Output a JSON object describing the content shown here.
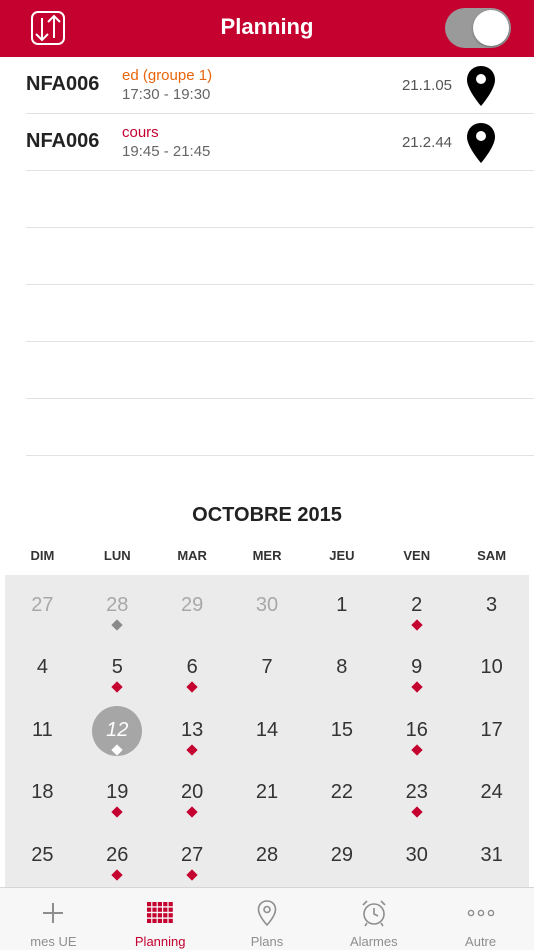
{
  "header": {
    "title": "Planning",
    "toggle_on": true
  },
  "colors": {
    "brand": "#c4012f",
    "ed_type": "#e8650a",
    "cours_type": "#c4012f"
  },
  "schedule": [
    {
      "code": "NFA006",
      "type": "ed (groupe 1)",
      "time": "17:30 - 19:30",
      "room": "21.1.05",
      "type_color": "#e8650a"
    },
    {
      "code": "NFA006",
      "type": "cours",
      "time": "19:45 - 21:45",
      "room": "21.2.44",
      "type_color": "#c4012f"
    }
  ],
  "calendar": {
    "month_title": "OCTOBRE 2015",
    "weekdays": [
      "DIM",
      "LUN",
      "MAR",
      "MER",
      "JEU",
      "VEN",
      "SAM"
    ],
    "weeks": [
      [
        {
          "d": "27",
          "other": true
        },
        {
          "d": "28",
          "other": true,
          "event": true
        },
        {
          "d": "29",
          "other": true
        },
        {
          "d": "30",
          "other": true
        },
        {
          "d": "1"
        },
        {
          "d": "2",
          "event": true
        },
        {
          "d": "3"
        }
      ],
      [
        {
          "d": "4"
        },
        {
          "d": "5",
          "event": true
        },
        {
          "d": "6",
          "event": true
        },
        {
          "d": "7"
        },
        {
          "d": "8"
        },
        {
          "d": "9",
          "event": true
        },
        {
          "d": "10"
        }
      ],
      [
        {
          "d": "11"
        },
        {
          "d": "12",
          "today": true,
          "event": true
        },
        {
          "d": "13",
          "event": true
        },
        {
          "d": "14"
        },
        {
          "d": "15"
        },
        {
          "d": "16",
          "event": true
        },
        {
          "d": "17"
        }
      ],
      [
        {
          "d": "18"
        },
        {
          "d": "19",
          "event": true
        },
        {
          "d": "20",
          "event": true
        },
        {
          "d": "21"
        },
        {
          "d": "22"
        },
        {
          "d": "23",
          "event": true
        },
        {
          "d": "24"
        }
      ],
      [
        {
          "d": "25"
        },
        {
          "d": "26",
          "event": true
        },
        {
          "d": "27",
          "event": true
        },
        {
          "d": "28"
        },
        {
          "d": "29"
        },
        {
          "d": "30"
        },
        {
          "d": "31"
        }
      ]
    ]
  },
  "tabs": [
    {
      "label": "mes UE",
      "icon": "plus-icon"
    },
    {
      "label": "Planning",
      "icon": "grid-icon",
      "active": true
    },
    {
      "label": "Plans",
      "icon": "map-pin-icon"
    },
    {
      "label": "Alarmes",
      "icon": "alarm-clock-icon"
    },
    {
      "label": "Autre",
      "icon": "more-dots-icon"
    }
  ]
}
